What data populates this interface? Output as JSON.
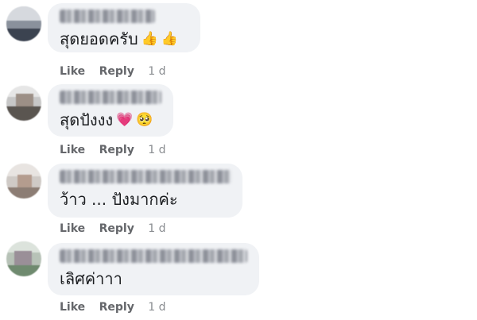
{
  "comments": [
    {
      "text": "สุดยอดครับ",
      "emoji": [
        "👍",
        "👍"
      ],
      "like": "Like",
      "reply": "Reply",
      "time": "1 d"
    },
    {
      "text": "สุดปังงง",
      "emoji": [
        "💗",
        "🥺"
      ],
      "like": "Like",
      "reply": "Reply",
      "time": "1 d"
    },
    {
      "text": "ว้าว ... ปังมากค่ะ",
      "emoji": [],
      "like": "Like",
      "reply": "Reply",
      "time": "1 d"
    },
    {
      "text": "เลิศค่าาา",
      "emoji": [],
      "like": "Like",
      "reply": "Reply",
      "time": "1 d"
    }
  ],
  "colors": {
    "bubble_bg": "#f0f2f5",
    "action_text": "#65676b",
    "comment_text": "#1c1e21"
  }
}
